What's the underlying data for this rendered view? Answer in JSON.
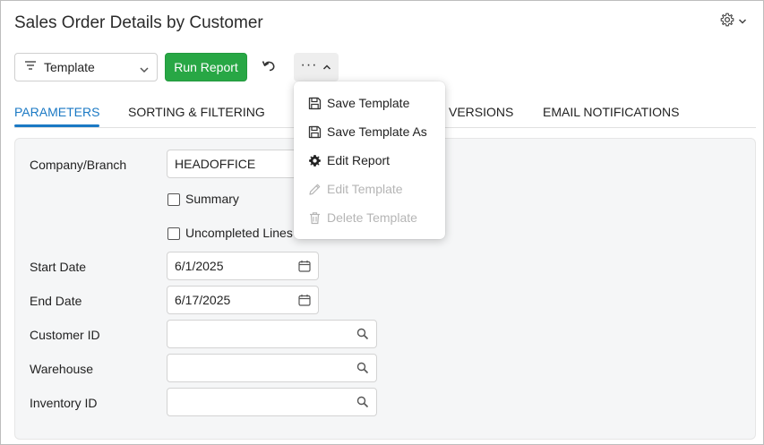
{
  "header": {
    "title": "Sales Order Details by Customer"
  },
  "toolbar": {
    "template_label": "Template",
    "run_label": "Run Report"
  },
  "tabs": [
    {
      "label": "PARAMETERS"
    },
    {
      "label": "SORTING & FILTERING"
    },
    {
      "label": "VERSIONS"
    },
    {
      "label": "EMAIL NOTIFICATIONS"
    }
  ],
  "params": {
    "company_label": "Company/Branch",
    "company_value": "HEADOFFICE",
    "summary_label": "Summary",
    "uncompleted_label": "Uncompleted Lines",
    "start_label": "Start Date",
    "start_value": "6/1/2025",
    "end_label": "End Date",
    "end_value": "6/17/2025",
    "customer_label": "Customer ID",
    "customer_value": "",
    "warehouse_label": "Warehouse",
    "warehouse_value": "",
    "inventory_label": "Inventory ID",
    "inventory_value": ""
  },
  "menu": {
    "items": [
      {
        "label": "Save Template",
        "icon": "save-icon",
        "enabled": true
      },
      {
        "label": "Save Template As",
        "icon": "save-icon",
        "enabled": true
      },
      {
        "label": "Edit Report",
        "icon": "gear-icon",
        "enabled": true
      },
      {
        "label": "Edit Template",
        "icon": "pencil-icon",
        "enabled": false
      },
      {
        "label": "Delete Template",
        "icon": "trash-icon",
        "enabled": false
      }
    ]
  },
  "colors": {
    "accent": "#1b79c4",
    "run_button": "#28a745",
    "disabled_text": "#b5b5b5"
  }
}
